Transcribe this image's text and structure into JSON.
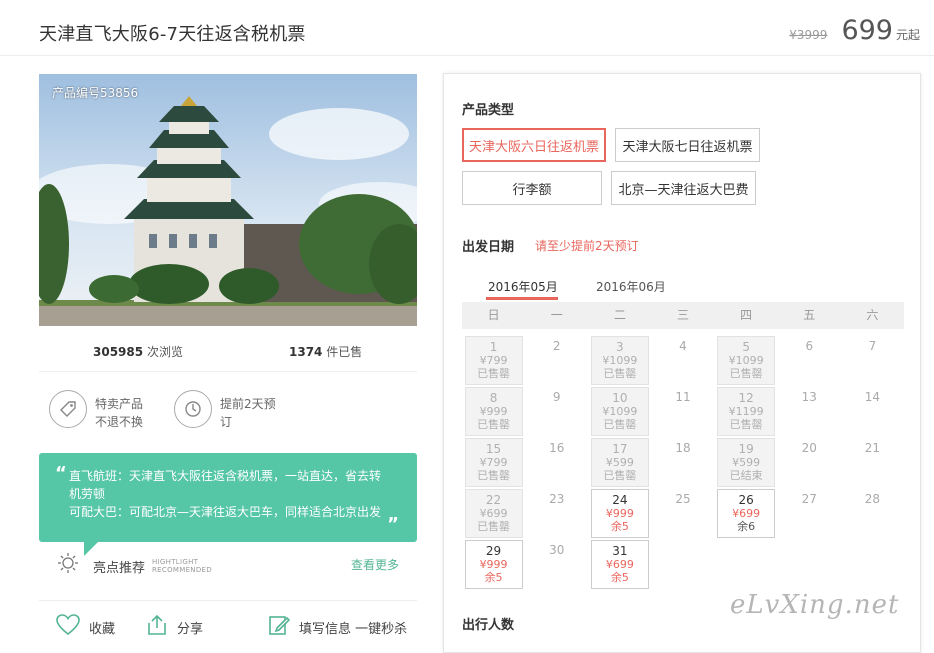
{
  "header": {
    "title": "天津直飞大阪6-7天往返含税机票",
    "old_price": "¥3999",
    "price": "699",
    "price_unit": "元起"
  },
  "product": {
    "product_id": "产品编号53856",
    "views_num": "305985",
    "views_label": "次浏览",
    "sold_num": "1374",
    "sold_label": "件已售"
  },
  "features": [
    {
      "icon": "tag-icon",
      "line1": "特卖产品",
      "line2": "不退不换"
    },
    {
      "icon": "clock-icon",
      "line1": "提前2天预",
      "line2": "订"
    }
  ],
  "highlight": {
    "line1": "直飞航班：天津直飞大阪往返含税机票，一站直达，省去转",
    "line2": "机劳顿",
    "line3": "可配大巴：可配北京—天津往返大巴车，同样适合北京出发",
    "label": "亮点推荐",
    "label_en1": "HIGHTLIGHT",
    "label_en2": "RECOMMENDED",
    "more": "查看更多"
  },
  "actions": {
    "favorite": "收藏",
    "share": "分享",
    "fill_info": "填写信息 一键秒杀"
  },
  "panel": {
    "type_label": "产品类型",
    "options": [
      "天津大阪六日往返机票",
      "天津大阪七日往返机票",
      "行李额",
      "北京—天津往返大巴费"
    ],
    "date_label": "出发日期",
    "date_hint": "请至少提前2天预订",
    "months": [
      "2016年05月",
      "2016年06月"
    ],
    "weekdays": [
      "日",
      "一",
      "二",
      "三",
      "四",
      "五",
      "六"
    ],
    "passenger_label": "出行人数"
  },
  "calendar": [
    {
      "d": "1",
      "p": "¥799",
      "s": "已售罄"
    },
    {
      "d": "2"
    },
    {
      "d": "3",
      "p": "¥1099",
      "s": "已售罄"
    },
    {
      "d": "4"
    },
    {
      "d": "5",
      "p": "¥1099",
      "s": "已售罄"
    },
    {
      "d": "6"
    },
    {
      "d": "7"
    },
    {
      "d": "8",
      "p": "¥999",
      "s": "已售罄"
    },
    {
      "d": "9"
    },
    {
      "d": "10",
      "p": "¥1099",
      "s": "已售罄"
    },
    {
      "d": "11"
    },
    {
      "d": "12",
      "p": "¥1199",
      "s": "已售罄"
    },
    {
      "d": "13"
    },
    {
      "d": "14"
    },
    {
      "d": "15",
      "p": "¥799",
      "s": "已售罄"
    },
    {
      "d": "16"
    },
    {
      "d": "17",
      "p": "¥599",
      "s": "已售罄"
    },
    {
      "d": "18"
    },
    {
      "d": "19",
      "p": "¥599",
      "s": "已结束"
    },
    {
      "d": "20"
    },
    {
      "d": "21"
    },
    {
      "d": "22",
      "p": "¥699",
      "s": "已售罄"
    },
    {
      "d": "23"
    },
    {
      "d": "24",
      "p": "¥999",
      "s": "余5",
      "avail": true
    },
    {
      "d": "25"
    },
    {
      "d": "26",
      "p": "¥699",
      "s": "余6",
      "avail": true
    },
    {
      "d": "27"
    },
    {
      "d": "28"
    },
    {
      "d": "29",
      "p": "¥999",
      "s": "余5",
      "avail": true
    },
    {
      "d": "30"
    },
    {
      "d": "31",
      "p": "¥699",
      "s": "余5",
      "avail": true
    }
  ],
  "watermark": "eLvXing.net"
}
